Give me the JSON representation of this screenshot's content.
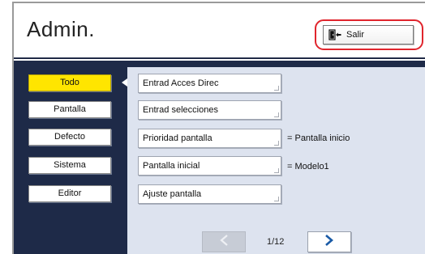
{
  "header": {
    "title": "Admin.",
    "exit_label": "Salir",
    "highlight_color": "#e0252d"
  },
  "categories": [
    {
      "label": "Todo",
      "active": true
    },
    {
      "label": "Pantalla",
      "active": false
    },
    {
      "label": "Defecto",
      "active": false
    },
    {
      "label": "Sistema",
      "active": false
    },
    {
      "label": "Editor",
      "active": false
    }
  ],
  "settings": [
    {
      "label": "Entrad Acces Direc",
      "value": ""
    },
    {
      "label": "Entrad selecciones",
      "value": ""
    },
    {
      "label": "Prioridad pantalla",
      "value": "= Pantalla inicio"
    },
    {
      "label": "Pantalla inicial",
      "value": "= Modelo1"
    },
    {
      "label": "Ajuste pantalla",
      "value": ""
    }
  ],
  "pager": {
    "page_text": "1/12",
    "prev_icon": "chevron-left-icon",
    "next_icon": "chevron-right-icon",
    "prev_enabled": false,
    "next_enabled": true
  },
  "colors": {
    "active_category": "#ffe500",
    "navy_background": "#1e2a48",
    "panel_background": "#dde3ef",
    "next_arrow": "#1a5aa6"
  }
}
